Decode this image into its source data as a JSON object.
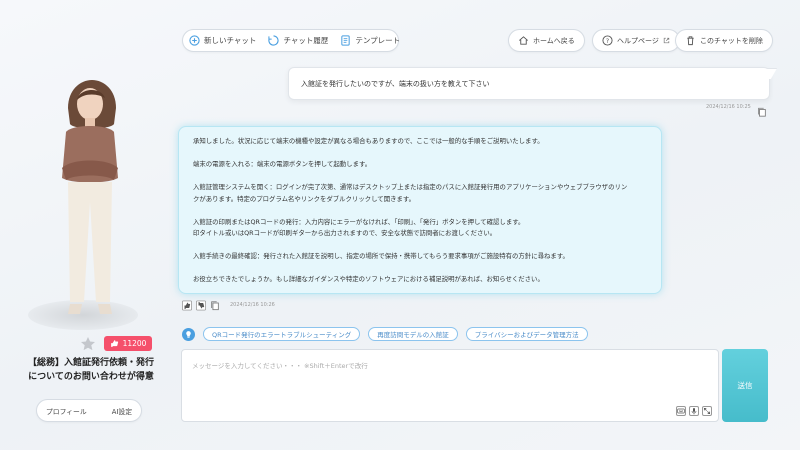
{
  "nav": {
    "new_chat": "新しいチャット",
    "history": "チャット履歴",
    "template": "テンプレート"
  },
  "top_actions": {
    "home": "ホームへ戻る",
    "help": "ヘルプページ",
    "delete": "このチャットを削除"
  },
  "conversation": {
    "user_message": "入館証を発行したいのですが、端末の扱い方を教えて下さい",
    "user_timestamp": "2024/12/16 10:25",
    "ai_lines": [
      "承知しました。状況に応じて端末の機種や設定が異なる場合もありますので、ここでは一般的な手順をご説明いたします。",
      "",
      "端末の電源を入れる：端末の電源ボタンを押して起動します。",
      "",
      "入館証管理システムを開く：ログインが完了次第、通常はデスクトップ上または指定のパスに入館証発行用のアプリケーションやウェブブラウザのリン",
      "クがあります。特定のプログラム名やリンクをダブルクリックして開きます。",
      "",
      "入館証の印刷またはQRコードの発行：入力内容にエラーがなければ、「印刷」、「発行」ボタンを押して確認します。",
      "印タイトル或いはQRコードが印刷ギターから出力されますので、安全な状態で訪問者にお渡しください。",
      "",
      "入館手続きの最終確認：発行された入館証を説明し、指定の場所で保持・携帯してもらう要求事項がご施設特有の方針に尋ねます。",
      "",
      "お役立ちできたでしょうか。もし詳細なガイダンスや特定のソフトウェアにおける補足説明があれば、お知らせください。"
    ],
    "ai_timestamp": "2024/12/16 10:26"
  },
  "suggestions": [
    "QRコード発行のエラートラブルシューティング",
    "再度訪問モデルの入館証",
    "プライバシーおよびデータ管理方法"
  ],
  "input": {
    "placeholder": "メッセージを入力してください・・・ ※Shift＋Enterで改行",
    "send_label": "送信"
  },
  "agent": {
    "score": "11200",
    "name": "【総務】入館証発行依頼・発行についてのお問い合わせが得意",
    "profile_tab": "プロフィール",
    "ai_settings_tab": "AI設定"
  },
  "colors": {
    "accent": "#4a9fe0",
    "send": "#4fc3d1",
    "score_badge": "#f5506b",
    "ai_bubble": "#e6f7fc"
  }
}
